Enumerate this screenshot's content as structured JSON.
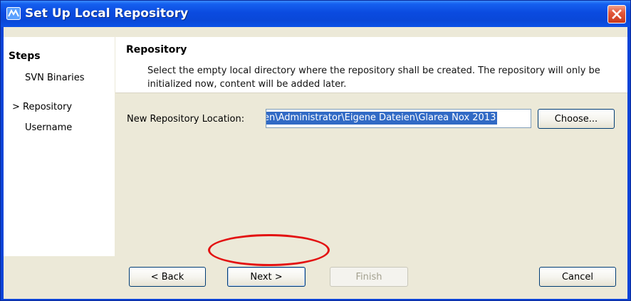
{
  "window": {
    "title": "Set Up Local Repository"
  },
  "steps": {
    "title": "Steps",
    "items": [
      {
        "label": "SVN Binaries",
        "current": false
      },
      {
        "label": "Repository",
        "current": true
      },
      {
        "label": "Username",
        "current": false
      }
    ],
    "current_marker": ">"
  },
  "header": {
    "title": "Repository",
    "description": "Select the empty local directory where the repository shall be created. The repository will only be initialized now, content will be added later."
  },
  "location": {
    "label": "New Repository Location:",
    "value": "en\\Administrator\\Eigene Dateien\\Glarea Nox 2013",
    "choose_label": "Choose..."
  },
  "buttons": {
    "back": "< Back",
    "next": "Next >",
    "finish": "Finish",
    "cancel": "Cancel"
  },
  "colors": {
    "titlebar": "#0b4be0",
    "client_bg": "#ece9d8",
    "selection": "#316ac5",
    "highlight": "#e31212"
  }
}
